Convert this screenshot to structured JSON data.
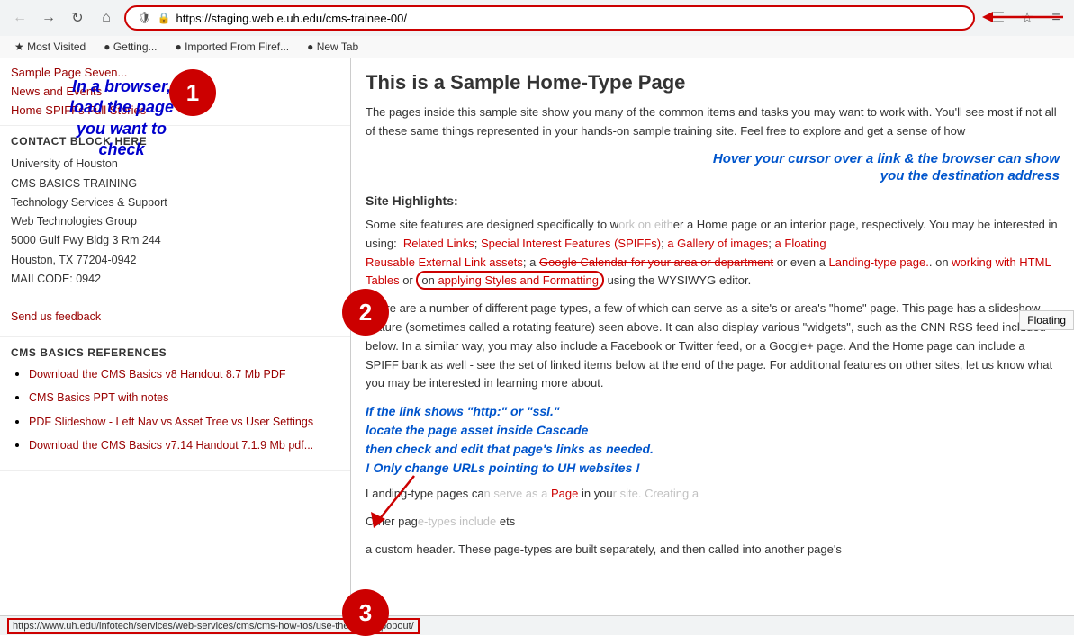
{
  "browser": {
    "url": "https://staging.web.e.uh.edu/cms-trainee-00/",
    "back_btn": "←",
    "forward_btn": "→",
    "reload_btn": "↺",
    "home_btn": "⌂",
    "bookmarks": [
      {
        "label": "Most Visited"
      },
      {
        "label": "Getting..."
      },
      {
        "label": "Imported From Firef..."
      },
      {
        "label": "New Tab"
      }
    ],
    "menu_icon": "☰",
    "reader_icon": "📄",
    "status_url": "https://www.uh.edu/infotech/services/web-services/cms/cms-how-tos/use-the-styles-popout/"
  },
  "sidebar": {
    "sample_page": "Sample Page Seven...",
    "nav_links": [
      {
        "label": "News and Events"
      },
      {
        "label": "Home SPIFFs Full Stories"
      }
    ],
    "contact_block_title": "CONTACT BLOCK HERE",
    "contact_info": [
      "University of Houston",
      "CMS BASICS TRAINING",
      "Technology Services & Support",
      "Web Technologies Group",
      "5000 Gulf Fwy Bldg 3 Rm 244",
      "Houston, TX 77204-0942",
      "MAILCODE: 0942"
    ],
    "send_feedback": "Send us feedback",
    "cms_ref_title": "CMS BASICS REFERENCES",
    "cms_refs": [
      {
        "label": "Download the CMS Basics v8 Handout 8.7 Mb PDF"
      },
      {
        "label": "CMS Basics PPT with notes"
      },
      {
        "label": "PDF Slideshow - Left Nav vs Asset Tree vs User Settings"
      },
      {
        "label": "Download the CMS Basics v7.14 Handout 7.1.9 Mb pdf..."
      }
    ]
  },
  "annotations": {
    "badge1_num": "1",
    "badge2_num": "2",
    "badge3_num": "3",
    "annotation1_line1": "In a browser,",
    "annotation1_line2": "load the page",
    "annotation1_line3": "you want to",
    "annotation1_line4": "check",
    "annotation2_line1": "Hover your cursor over a link & the browser can show",
    "annotation2_line2": "you the destination address",
    "annotation3_line1": "If the link shows \"http:\" or \"ssl.\"",
    "annotation3_line2": "locate the page asset inside Cascade",
    "annotation3_line3": "then check and edit that page's links as needed.",
    "annotation3_line4": "! Only change URLs pointing to UH websites !"
  },
  "main": {
    "title": "This is a Sample Home-Type Page",
    "para1": "The pages inside this sample site show you many of the common items and tasks you may want to work with. You'll see most if not all of these same things represented in your hands-on sample training site. Feel free to explore and get a sense of how",
    "site_highlights_label": "Site Highlights:",
    "para2_start": "Some site features are designed specifically to work on either a Home page or an interior page, respectively. You may be interested in using:",
    "links": [
      {
        "label": "Related Links"
      },
      {
        "label": "Special Interest Features (SPIFFs)"
      },
      {
        "label": "a Gallery of images"
      },
      {
        "label": "a Floating Reusable External Link assets"
      }
    ],
    "para2_mid": "a",
    "google_cal_link": "Google Calendar for your area or department",
    "para2_mid2": "or even a",
    "landing_link": "Landing-type page.",
    "para2_end1": "on",
    "working_tables_link": "working with HTML Tables",
    "para2_end2": "or on",
    "styles_link": "applying Styles and Formatting",
    "para2_end3": "using the WYSIWYG editor.",
    "para3": "There are a number of different page types, a few of which can serve as a site's or area's \"home\" page. This page has a slideshow feature (sometimes called a rotating feature) seen above. It can also display various \"widgets\", such as the CNN RSS feed included below. In a similar way, you may also include a Facebook or Twitter feed, or a Google+ page. And the Home page can include a SPIFF bank as well - see the set of linked items below at the end of the page. For additional features on other sites, let us know what you may be interested in learning more about.",
    "para4_start": "Landing-type pages ca",
    "page_link": "Page",
    "para4_mid": "in you",
    "para5_start": "Other pag",
    "para5_end": "ets",
    "para6": "a custom header. These page-types are built separately, and then called into another page's",
    "floating_label": "Floating"
  }
}
